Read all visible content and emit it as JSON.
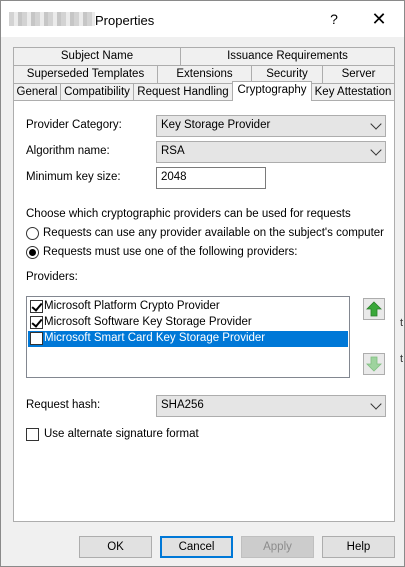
{
  "window": {
    "title": "Properties",
    "help": "?",
    "close": "✕"
  },
  "tabs": {
    "row1": [
      "Subject Name",
      "Issuance Requirements"
    ],
    "row2": [
      "Superseded Templates",
      "Extensions",
      "Security",
      "Server"
    ],
    "row3": [
      "General",
      "Compatibility",
      "Request Handling",
      "Cryptography",
      "Key Attestation"
    ],
    "active": "Cryptography"
  },
  "form": {
    "provider_category_label": "Provider Category:",
    "provider_category_value": "Key Storage Provider",
    "algorithm_label": "Algorithm name:",
    "algorithm_value": "RSA",
    "min_key_label": "Minimum key size:",
    "min_key_value": "2048",
    "choose_text": "Choose which cryptographic providers can be used for requests",
    "radio_any": "Requests can use any provider available on the subject's computer",
    "radio_listed": "Requests must use one of the following providers:",
    "radio_selected": "listed",
    "providers_label": "Providers:",
    "providers": [
      {
        "name": "Microsoft Platform Crypto Provider",
        "checked": true,
        "selected": false
      },
      {
        "name": "Microsoft Software Key Storage Provider",
        "checked": true,
        "selected": false
      },
      {
        "name": "Microsoft Smart Card Key Storage Provider",
        "checked": false,
        "selected": true
      }
    ],
    "request_hash_label": "Request hash:",
    "request_hash_value": "SHA256",
    "alt_sig_label": "Use alternate signature format",
    "alt_sig_checked": false
  },
  "buttons": {
    "ok": "OK",
    "cancel": "Cancel",
    "apply": "Apply",
    "help": "Help"
  },
  "edge_fragments": [
    "t",
    "t"
  ],
  "colors": {
    "selection": "#0078d7",
    "arrow_up": "#3aa83a",
    "arrow_down_disabled": "#9ed39e"
  }
}
